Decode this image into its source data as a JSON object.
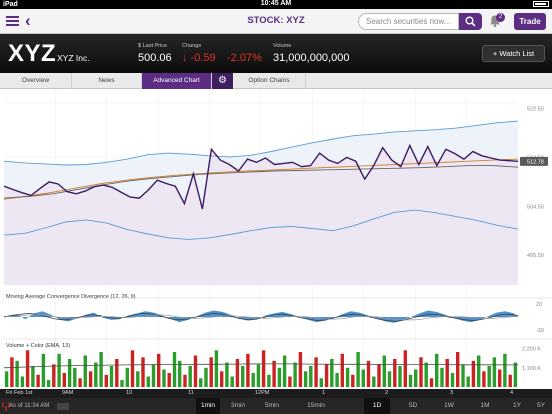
{
  "statusbar": {
    "carrier": "iPad",
    "time": "10:45 AM"
  },
  "nav": {
    "title": "STOCK: XYZ",
    "search_placeholder": "Search securities now...",
    "notifications": "2",
    "trade_label": "Trade"
  },
  "quote": {
    "symbol": "XYZ",
    "company": "XYZ Inc.",
    "last_price_label": "$ Last Price",
    "last_price": "500.06",
    "change_label": "Change",
    "change": "-0.59",
    "change_pct": "-2.07%",
    "volume_label": "Volume",
    "volume": "31,000,000,000",
    "watchlist_label": "Watch List"
  },
  "tabs": [
    {
      "label": "Overview",
      "active": false
    },
    {
      "label": "News",
      "active": false
    },
    {
      "label": "Advanced Chart",
      "active": true
    },
    {
      "label": "Option Chains",
      "active": false
    }
  ],
  "colors": {
    "brand": "#5b2d83",
    "price_line": "#3d1a62",
    "band": "#5b9bd5",
    "ma_orange": "#d07a2a",
    "ma_gray": "#666666",
    "volume_up": "#2a9d2a",
    "volume_down": "#cc2222",
    "negative": "#e0302a"
  },
  "chart_data": [
    {
      "type": "line",
      "title": "",
      "y_ticks": [
        "522.50",
        "513.50",
        "512.78",
        "504.50",
        "495.50"
      ],
      "ylim": [
        490,
        525
      ],
      "price_tag": "512.78",
      "x_ticks": [
        "Fri Feb 1st",
        "9AM",
        "10",
        "11",
        "12PM",
        "1",
        "2",
        "3",
        "4"
      ],
      "series": [
        {
          "values": [
            508.2,
            507.6,
            507.0,
            506.5,
            507.8,
            509.0,
            508.6,
            507.2,
            506.8,
            507.3,
            508.1,
            508.4,
            508.0,
            507.1,
            506.2,
            506.0,
            507.5,
            509.3,
            508.7,
            508.2,
            505.0,
            510.5,
            504.0,
            515.0,
            513.0,
            512.2,
            511.0,
            513.2,
            512.6,
            513.4,
            512.2,
            512.4,
            512.6,
            511.8,
            512.0,
            514.3,
            513.0,
            512.4,
            513.5,
            512.8,
            509.5,
            512.0,
            515.3,
            513.0,
            511.8,
            515.7,
            512.2,
            515.5,
            512.0,
            515.0,
            514.2,
            513.2,
            514.6,
            513.8,
            513.4,
            513.0,
            512.9,
            512.78
          ]
        },
        {
          "values": [
            512.8,
            512.5,
            512.3,
            512.1,
            512.2,
            512.6,
            513.2,
            514.0,
            514.3,
            514.1,
            513.8,
            513.6,
            513.9,
            514.6,
            515.4,
            516.2,
            516.9,
            517.5,
            517.8,
            518.2,
            518.4,
            518.6,
            518.9,
            519.4,
            519.9,
            520.2
          ]
        },
        {
          "values": [
            499.2,
            499.5,
            500.5,
            501.6,
            502.0,
            501.4,
            500.2,
            499.4,
            498.7,
            498.4,
            498.7,
            499.3,
            500.0,
            500.6,
            500.8,
            500.4,
            500.0,
            500.9,
            502.2,
            503.4,
            503.8,
            503.3,
            502.6,
            501.9,
            501.0,
            500.3
          ]
        },
        {
          "values": [
            505.8,
            506.4,
            507.1,
            507.9,
            508.7,
            509.3,
            509.8,
            510.2,
            510.5,
            510.8,
            511.0,
            511.2,
            511.4,
            511.6,
            511.8,
            512.0,
            512.2,
            512.4,
            512.6,
            512.8,
            513.0,
            513.2
          ]
        },
        {
          "values": [
            506.0,
            506.3,
            506.8,
            507.6,
            508.4,
            509.1,
            509.6,
            510.0,
            510.4,
            510.6,
            510.8,
            511.0,
            511.1,
            511.2,
            511.3,
            511.4,
            511.5,
            511.6,
            511.8,
            512.0,
            512.0,
            511.7
          ]
        }
      ]
    },
    {
      "type": "area",
      "title": "Moving Average Convergence Divergence (12, 26, 9)",
      "y_ticks": [
        "20",
        "-20"
      ],
      "ylim": [
        -22,
        22
      ],
      "histogram": [
        2,
        4,
        -3,
        5,
        8,
        3,
        -4,
        -6,
        -2,
        3,
        6,
        -1,
        -4,
        -3,
        2,
        5,
        8,
        6,
        2,
        -3,
        -7,
        -4,
        1,
        6,
        9,
        7,
        3,
        -2,
        -5,
        -3,
        2,
        5,
        7,
        4,
        0,
        -4,
        -7,
        -5,
        -1,
        4,
        8,
        6,
        2,
        -2,
        -6,
        -8,
        -5,
        0,
        5,
        9,
        7,
        3,
        -1,
        -5,
        -7,
        -4,
        1,
        6,
        8,
        5
      ],
      "line_a": [
        0,
        2,
        4,
        5,
        3,
        0,
        -3,
        -4,
        -2,
        1,
        3,
        2,
        -1,
        -2,
        0,
        3,
        5,
        4,
        1,
        -2,
        -4,
        -3,
        0,
        3,
        5,
        4,
        1,
        -2,
        -4,
        -3,
        0,
        3,
        4,
        2,
        -1,
        -3,
        -5,
        -4,
        -1,
        2,
        4,
        3,
        0,
        -3,
        -5,
        -6,
        -4,
        -1,
        2,
        4,
        3,
        0,
        -2,
        -4,
        -5,
        -3,
        0,
        3,
        4,
        2
      ],
      "line_b": [
        1,
        1,
        2,
        3,
        3,
        2,
        0,
        -1,
        -2,
        -1,
        0,
        1,
        1,
        0,
        -1,
        0,
        1,
        2,
        3,
        2,
        0,
        -1,
        -2,
        -1,
        0,
        1,
        2,
        1,
        0,
        -1,
        -2,
        -1,
        0,
        1,
        1,
        0,
        -2,
        -3,
        -3,
        -2,
        0,
        1,
        1,
        0,
        -2,
        -3,
        -4,
        -4,
        -3,
        -1,
        0,
        1,
        1,
        0,
        -1,
        -2,
        -2,
        -1,
        0,
        1
      ]
    },
    {
      "type": "bar",
      "title": "Volume + Color (EMA, 13)",
      "y_ticks": [
        "2,200 K",
        "1,100 K"
      ],
      "ylim": [
        0,
        2400
      ],
      "values": [
        900,
        1700,
        1500,
        600,
        2100,
        1200,
        700,
        1900,
        400,
        1300,
        1900,
        800,
        1600,
        1100,
        500,
        1800,
        900,
        1400,
        2000,
        700,
        1200,
        1600,
        400,
        1100,
        2100,
        900,
        1700,
        600,
        1300,
        1900,
        1000,
        800,
        2000,
        1500,
        700,
        1200,
        1800,
        500,
        1100,
        1700,
        2100,
        900,
        1400,
        600,
        1600,
        1200,
        1900,
        800,
        1300,
        2100,
        700,
        1500,
        1100,
        1800,
        600,
        1400,
        2000,
        900,
        1200,
        1700,
        500,
        1300,
        1600,
        800,
        1900,
        1100,
        700,
        2000,
        1000,
        1500,
        600,
        1300,
        1800,
        900,
        1600,
        1200,
        2100,
        700,
        1000,
        1700,
        1400,
        500,
        1900,
        1100,
        1600,
        800,
        2000,
        1300,
        600,
        1500,
        1800,
        900,
        1200,
        1700,
        1000,
        1900,
        700,
        1400
      ],
      "up": [
        1,
        0,
        1,
        1,
        0,
        1,
        0,
        1,
        1,
        0,
        1,
        0,
        1,
        1,
        0,
        1,
        0,
        1,
        1,
        0,
        1,
        0,
        1,
        1,
        0,
        1,
        0,
        1,
        1,
        0,
        1,
        0,
        1,
        1,
        0,
        1,
        0,
        1,
        1,
        0,
        1,
        0,
        1,
        1,
        0,
        1,
        0,
        1,
        1,
        0,
        1,
        0,
        1,
        1,
        0,
        1,
        0,
        1,
        1,
        0,
        1,
        0,
        1,
        1,
        0,
        1,
        0,
        1,
        1,
        0,
        1,
        0,
        1,
        1,
        0,
        1,
        0,
        1,
        1,
        0,
        1,
        0,
        1,
        1,
        0,
        1,
        0,
        1,
        1,
        0,
        1,
        0,
        1,
        1,
        0,
        1,
        0,
        1
      ],
      "ema": [
        1100,
        1150,
        1200,
        1230,
        1250,
        1270,
        1280,
        1290,
        1300,
        1310,
        1320,
        1320,
        1310,
        1300,
        1300,
        1290,
        1280,
        1280,
        1270,
        1270,
        1260
      ]
    }
  ],
  "footer": {
    "as_of": "As of 11:34 AM",
    "intervals": [
      {
        "label": "1min",
        "selected": true
      },
      {
        "label": "3min",
        "selected": false
      },
      {
        "label": "5min",
        "selected": false
      },
      {
        "label": "15min",
        "selected": false
      }
    ],
    "ranges": [
      {
        "label": "1D",
        "selected": true
      },
      {
        "label": "5D",
        "selected": false
      },
      {
        "label": "1W",
        "selected": false
      },
      {
        "label": "1M",
        "selected": false
      },
      {
        "label": "1Y",
        "selected": false
      },
      {
        "label": "5Y",
        "selected": false
      }
    ]
  }
}
